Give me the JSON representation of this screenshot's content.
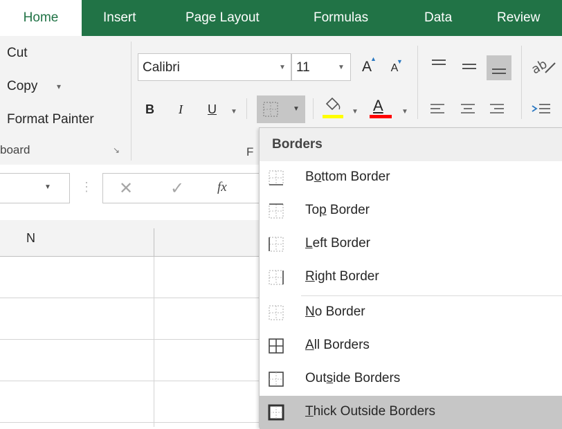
{
  "tabs": [
    "Home",
    "Insert",
    "Page Layout",
    "Formulas",
    "Data",
    "Review"
  ],
  "clipboard": {
    "cut": "Cut",
    "copy": "Copy",
    "copy_caret": "▾",
    "format_painter": "Format Painter",
    "group_label": "board",
    "launcher": "↘"
  },
  "font": {
    "name": "Calibri",
    "size": "11",
    "grow": "A",
    "shrink": "A",
    "bold": "B",
    "italic": "I",
    "underline": "U",
    "group_label_partial": "F"
  },
  "formula_bar": {
    "cancel": "✕",
    "enter": "✓",
    "fx": "fx"
  },
  "columns": [
    "N"
  ],
  "menu": {
    "title": "Borders",
    "items": [
      {
        "pre": "B",
        "u": "o",
        "post": "ttom Border"
      },
      {
        "pre": "To",
        "u": "p",
        "post": " Border"
      },
      {
        "pre": "",
        "u": "L",
        "post": "eft Border"
      },
      {
        "pre": "",
        "u": "R",
        "post": "ight Border"
      },
      {
        "pre": "",
        "u": "N",
        "post": "o Border"
      },
      {
        "pre": "",
        "u": "A",
        "post": "ll Borders"
      },
      {
        "pre": "Out",
        "u": "s",
        "post": "ide Borders"
      },
      {
        "pre": "",
        "u": "T",
        "post": "hick Outside Borders"
      }
    ]
  },
  "colors": {
    "ribbon_green": "#217346",
    "fill_yellow": "#ffff00",
    "font_red": "#ff0000",
    "selected_item": "#c6c6c6"
  }
}
